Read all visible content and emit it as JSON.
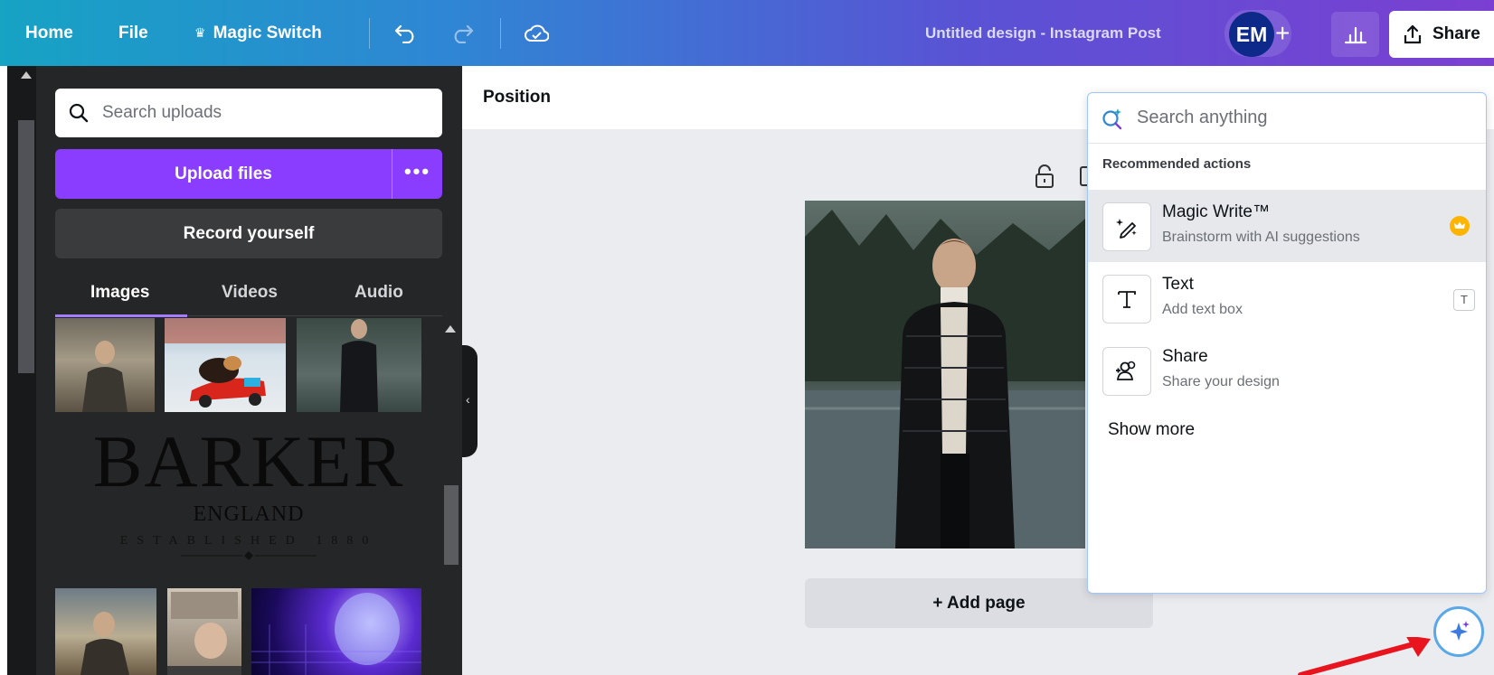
{
  "topbar": {
    "home": "Home",
    "file": "File",
    "magic_switch": "Magic Switch",
    "design_title": "Untitled design - Instagram Post",
    "avatar_initials": "EM",
    "share": "Share"
  },
  "uploads_panel": {
    "search_placeholder": "Search uploads",
    "upload_button": "Upload files",
    "more_options": "•••",
    "record_button": "Record yourself",
    "tabs": [
      "Images",
      "Videos",
      "Audio"
    ],
    "active_tab": "Images",
    "logo_lines": [
      "BARKER",
      "ENGLAND",
      "ESTABLISHED 1880"
    ]
  },
  "editor": {
    "context_label": "Position",
    "add_page": "+ Add page"
  },
  "command_popup": {
    "search_placeholder": "Search anything",
    "section_title": "Recommended actions",
    "actions": [
      {
        "title": "Magic Write™",
        "subtitle": "Brainstorm with AI suggestions",
        "icon": "magic-write-icon",
        "badge": "crown-icon"
      },
      {
        "title": "Text",
        "subtitle": "Add text box",
        "icon": "text-icon",
        "shortcut": "T"
      },
      {
        "title": "Share",
        "subtitle": "Share your design",
        "icon": "share-people-icon"
      }
    ],
    "show_more": "Show more"
  },
  "colors": {
    "accent_purple": "#8b3dff",
    "panel_dark": "#252627",
    "crown_gold": "#ffb400",
    "arrow_red": "#e8141e"
  }
}
